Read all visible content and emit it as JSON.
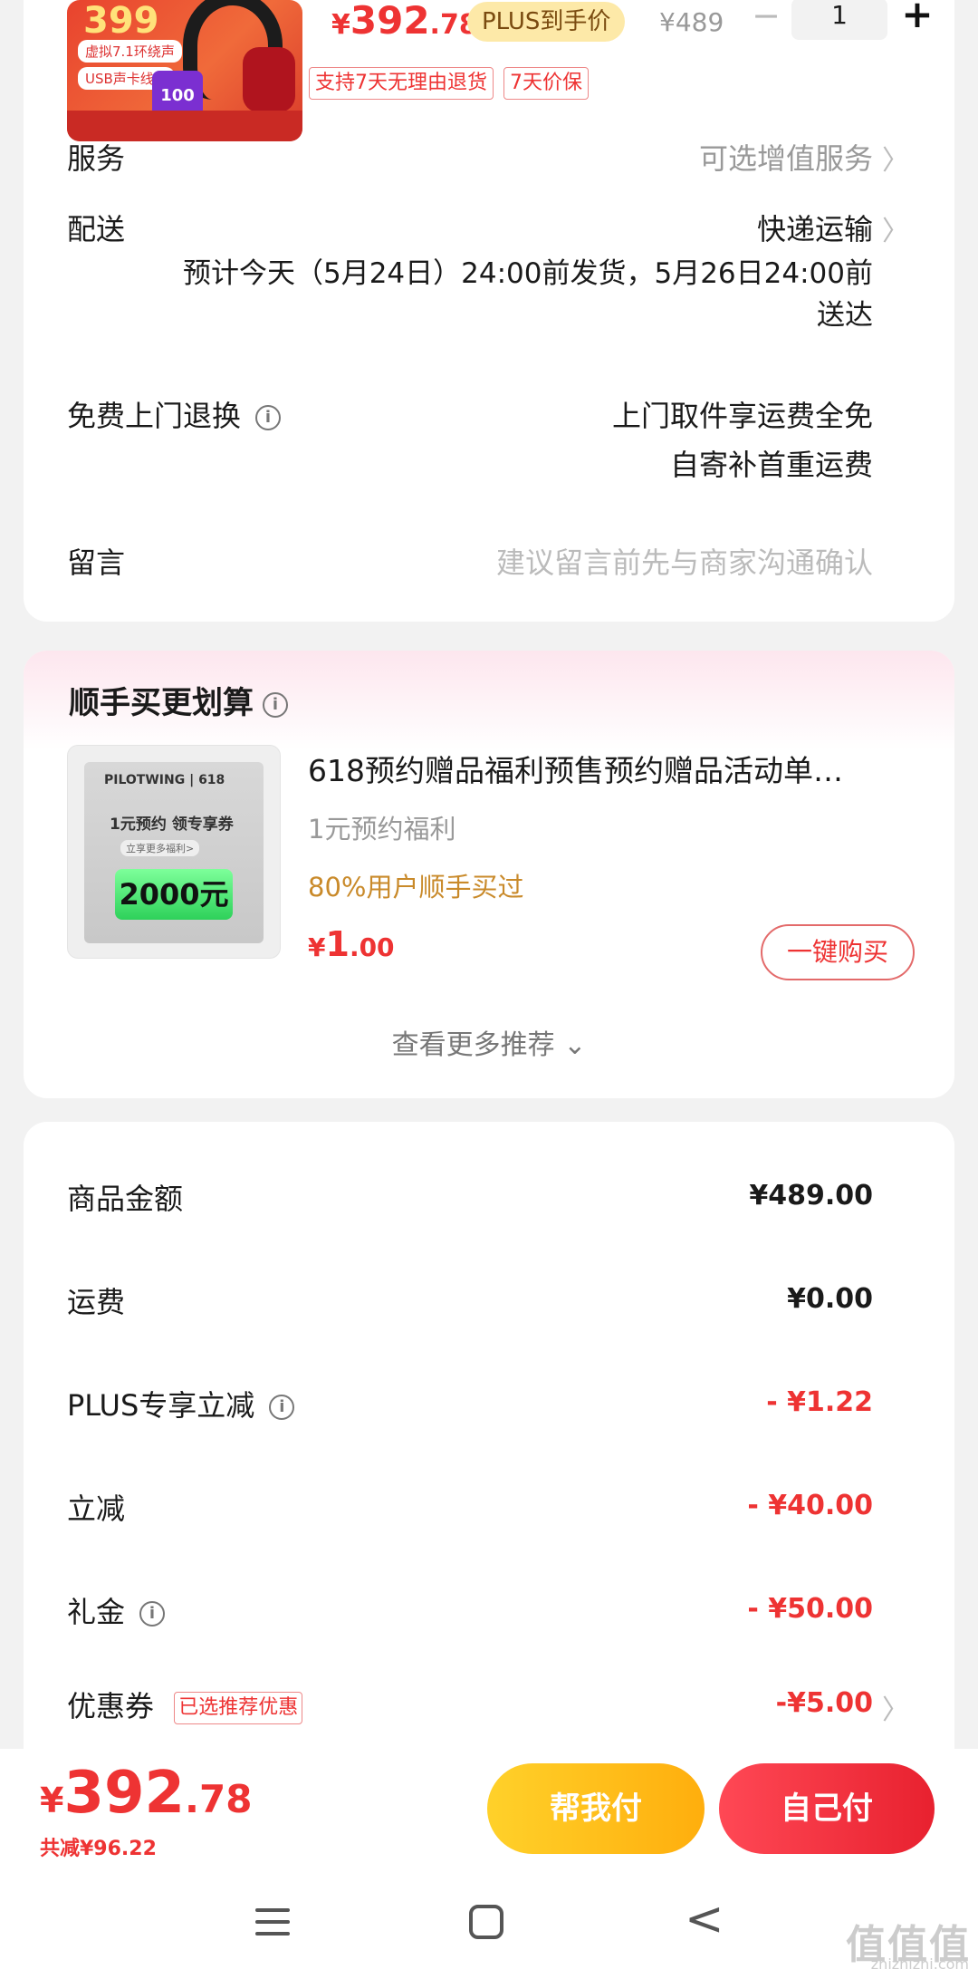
{
  "product": {
    "thumb_badge": "399",
    "thumb_tag1": "虚拟7.1环绕声",
    "thumb_tag2": "USB声卡线控",
    "thumb_badge2": "100",
    "price_symbol": "¥",
    "price_int": "392",
    "price_dec": ".78",
    "plus_label": "PLUS到手价",
    "old_price": "¥489",
    "qty": "1",
    "minus": "−",
    "plus": "+",
    "tag_return": "支持7天无理由退货",
    "tag_price": "7天价保"
  },
  "service": {
    "label": "服务",
    "value": "可选增值服务"
  },
  "delivery": {
    "label": "配送",
    "value": "快递运输",
    "eta_line1": "预计今天（5月24日）24:00前发货，5月26日24:00前",
    "eta_line2": "送达"
  },
  "free_return": {
    "label": "免费上门退换",
    "line1": "上门取件享运费全免",
    "line2": "自寄补首重运费"
  },
  "message": {
    "label": "留言",
    "placeholder": "建议留言前先与商家沟通确认"
  },
  "recommend": {
    "title": "顺手买更划算",
    "item": {
      "img_brand": "PILOTWING | 618",
      "img_line1": "1元预约  领专享券",
      "img_line2": "立享更多福利>",
      "img_amount": "2000元",
      "title": "618预约赠品福利预售预约赠品活动单…",
      "subtitle": "1元预约福利",
      "social": "80%用户顺手买过",
      "price_symbol": "¥",
      "price_int": "1",
      "price_dec": ".00",
      "buy_label": "一键购买"
    },
    "more_label": "查看更多推荐 ⌄"
  },
  "summary": {
    "goods_label": "商品金额",
    "goods_value": "¥489.00",
    "ship_label": "运费",
    "ship_value": "¥0.00",
    "plus_label": "PLUS专享立减",
    "plus_value": "- ¥1.22",
    "discount_label": "立减",
    "discount_value": "- ¥40.00",
    "gift_label": "礼金",
    "gift_value": "- ¥50.00",
    "coupon_label": "优惠券",
    "coupon_tag": "已选推荐优惠",
    "coupon_value": "-¥5.00"
  },
  "bottom": {
    "symbol": "¥",
    "int": "392",
    "dec": ".78",
    "saved": "共减¥96.22",
    "help_label": "帮我付",
    "self_label": "自己付"
  },
  "watermark": {
    "text": "值值值",
    "url": "zhizhizhi.com"
  },
  "colors": {
    "accent_red": "#e33333",
    "plus_gold": "#fde9a8",
    "help_yellow": "#ffb80d",
    "social_orange": "#c98a2a"
  },
  "icons": [
    "chevron-right-icon",
    "info-icon",
    "menu-icon",
    "home-icon",
    "back-icon"
  ]
}
